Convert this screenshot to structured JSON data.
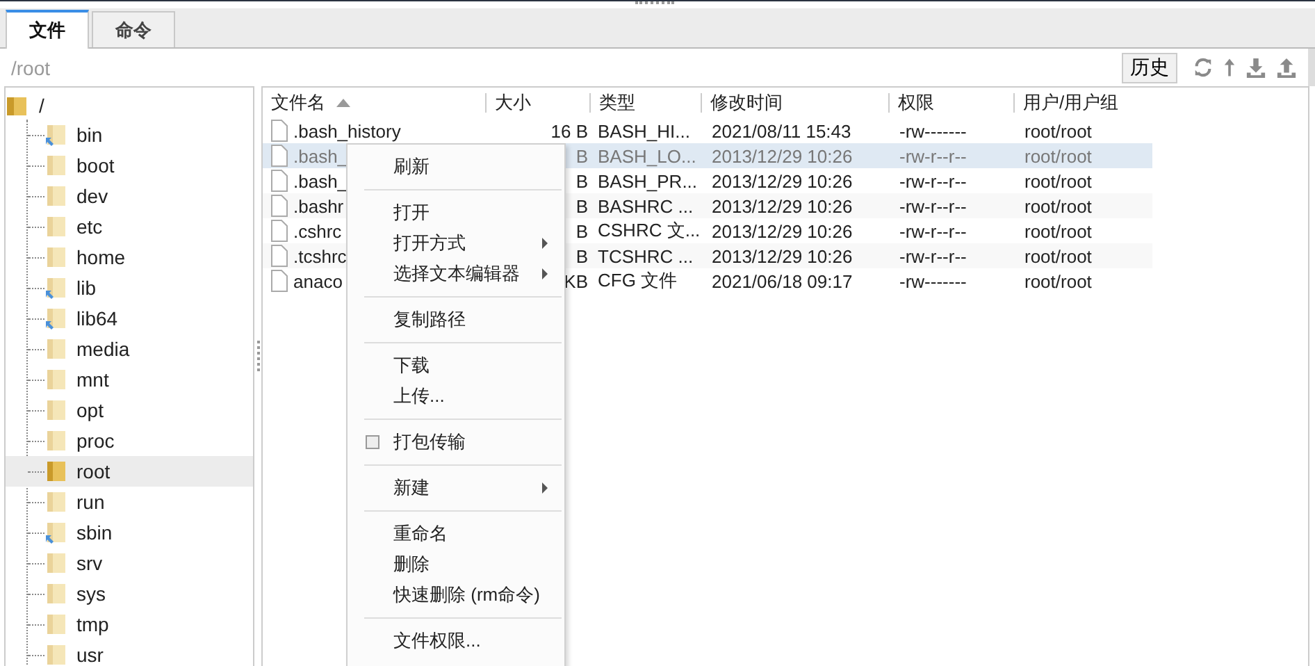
{
  "tabs": [
    {
      "label": "文件",
      "selected": true
    },
    {
      "label": "命令",
      "selected": false
    }
  ],
  "path_bar": {
    "path": "/root",
    "history_button": "历史"
  },
  "tree": {
    "label": "/",
    "expanded": true,
    "children": [
      {
        "label": "bin",
        "kind": "link",
        "selected": false
      },
      {
        "label": "boot",
        "kind": "folder",
        "selected": false
      },
      {
        "label": "dev",
        "kind": "folder",
        "selected": false
      },
      {
        "label": "etc",
        "kind": "folder",
        "selected": false
      },
      {
        "label": "home",
        "kind": "folder",
        "selected": false
      },
      {
        "label": "lib",
        "kind": "link",
        "selected": false
      },
      {
        "label": "lib64",
        "kind": "link",
        "selected": false
      },
      {
        "label": "media",
        "kind": "folder",
        "selected": false
      },
      {
        "label": "mnt",
        "kind": "folder",
        "selected": false
      },
      {
        "label": "opt",
        "kind": "folder",
        "selected": false
      },
      {
        "label": "proc",
        "kind": "folder",
        "selected": false
      },
      {
        "label": "root",
        "kind": "folder",
        "selected": true
      },
      {
        "label": "run",
        "kind": "folder",
        "selected": false
      },
      {
        "label": "sbin",
        "kind": "link",
        "selected": false
      },
      {
        "label": "srv",
        "kind": "folder",
        "selected": false
      },
      {
        "label": "sys",
        "kind": "folder",
        "selected": false
      },
      {
        "label": "tmp",
        "kind": "folder",
        "selected": false
      },
      {
        "label": "usr",
        "kind": "folder",
        "selected": false
      }
    ]
  },
  "table": {
    "columns": [
      "文件名",
      "大小",
      "类型",
      "修改时间",
      "权限",
      "用户/用户组"
    ],
    "rows": [
      {
        "name": ".bash_history",
        "size": "16 B",
        "type": "BASH_HI...",
        "modified": "2021/08/11 15:43",
        "permissions": "-rw-------",
        "owner": "root/root",
        "selected": false
      },
      {
        "name": ".bash_",
        "size": "B",
        "type": "BASH_LO...",
        "modified": "2013/12/29 10:26",
        "permissions": "-rw-r--r--",
        "owner": "root/root",
        "selected": true
      },
      {
        "name": ".bash_",
        "size": "B",
        "type": "BASH_PR...",
        "modified": "2013/12/29 10:26",
        "permissions": "-rw-r--r--",
        "owner": "root/root",
        "selected": false
      },
      {
        "name": ".bashr",
        "size": "B",
        "type": "BASHRC ...",
        "modified": "2013/12/29 10:26",
        "permissions": "-rw-r--r--",
        "owner": "root/root",
        "selected": false
      },
      {
        "name": ".cshrc",
        "size": "B",
        "type": "CSHRC 文...",
        "modified": "2013/12/29 10:26",
        "permissions": "-rw-r--r--",
        "owner": "root/root",
        "selected": false
      },
      {
        "name": ".tcshrc",
        "size": "B",
        "type": "TCSHRC ...",
        "modified": "2013/12/29 10:26",
        "permissions": "-rw-r--r--",
        "owner": "root/root",
        "selected": false
      },
      {
        "name": "anaco",
        "size": "KB",
        "type": "CFG 文件",
        "modified": "2021/06/18 09:17",
        "permissions": "-rw-------",
        "owner": "root/root",
        "selected": false
      }
    ]
  },
  "context_menu": {
    "groups": [
      [
        {
          "label": "刷新",
          "kind": "item"
        }
      ],
      [
        {
          "label": "打开",
          "kind": "item"
        },
        {
          "label": "打开方式",
          "kind": "submenu"
        },
        {
          "label": "选择文本编辑器",
          "kind": "submenu"
        }
      ],
      [
        {
          "label": "复制路径",
          "kind": "item"
        }
      ],
      [
        {
          "label": "下载",
          "kind": "item"
        },
        {
          "label": "上传...",
          "kind": "item"
        }
      ],
      [
        {
          "label": "打包传输",
          "kind": "checkbox",
          "checked": false
        }
      ],
      [
        {
          "label": "新建",
          "kind": "submenu"
        }
      ],
      [
        {
          "label": "重命名",
          "kind": "item"
        },
        {
          "label": "删除",
          "kind": "item"
        },
        {
          "label": "快速删除 (rm命令)",
          "kind": "item"
        }
      ],
      [
        {
          "label": "文件权限...",
          "kind": "item"
        }
      ]
    ]
  }
}
